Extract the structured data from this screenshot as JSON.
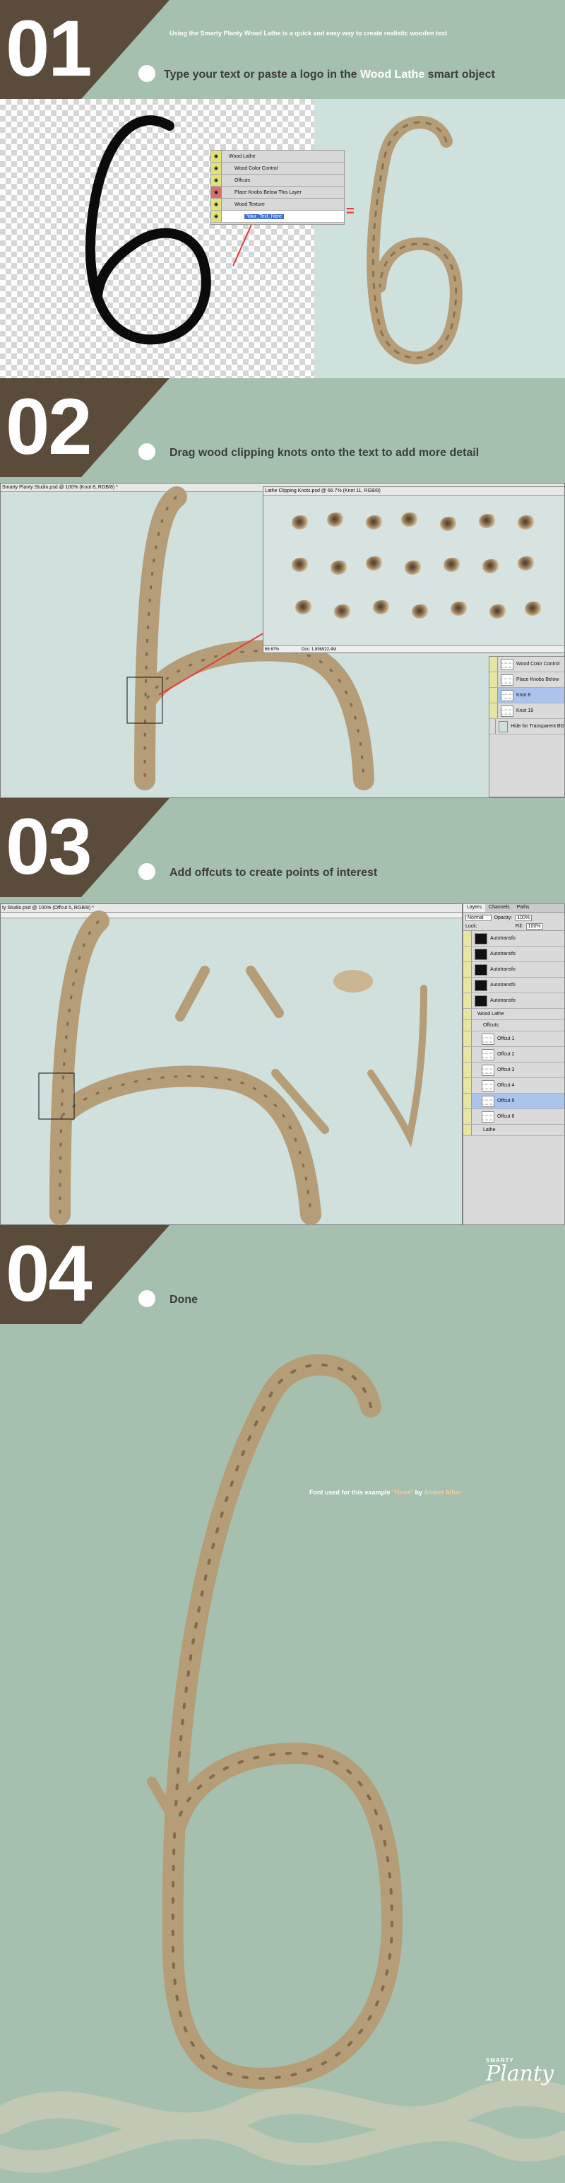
{
  "intro_text": "Using the Smarty Planty Wood Lathe is a quick and easy way to create realistic wooden text",
  "steps": [
    {
      "number": "01",
      "title_pre": "Type your text or paste a logo in the ",
      "title_highlight": "Wood Lathe",
      "title_post": " smart object"
    },
    {
      "number": "02",
      "title": "Drag wood clipping knots onto the text to add more detail"
    },
    {
      "number": "03",
      "title": "Add offcuts to create points of interest"
    },
    {
      "number": "04",
      "title": "Done"
    }
  ],
  "step1_layers": [
    {
      "label": "Wood Lathe",
      "eye": "yellow"
    },
    {
      "label": "Wood Color Control",
      "eye": "yellow"
    },
    {
      "label": "Offcuts",
      "eye": "yellow"
    },
    {
      "label": "Place Knobs Below This Layer",
      "eye": "red"
    },
    {
      "label": "Wood Texture",
      "eye": "yellow"
    },
    {
      "label": "Your_Text_Here",
      "eye": "yellow",
      "selected": true
    }
  ],
  "step1_equals": "=",
  "step2": {
    "main_title": "Smarty Planty Studio.psd @ 100% (Knot 8, RGB/8) *",
    "knot_title": "Lathe Clipping Knots.psd @ 66.7% (Knot 11, RGB/8)",
    "zoom": "66.67%",
    "doc_info": "Doc: 1.89M/22.4M",
    "layers": [
      {
        "label": "Wood Color Control",
        "thumb": "light"
      },
      {
        "label": "Place Knobs Below",
        "thumb": "light"
      },
      {
        "label": "Knot 8",
        "thumb": "light",
        "selected": true
      },
      {
        "label": "Knot 19",
        "thumb": "light"
      },
      {
        "label": "Hide for Transparent BG",
        "thumb": "light"
      }
    ]
  },
  "step3": {
    "main_title": "ty Studio.psd @ 100% (Offcut 5, RGB/8) *",
    "tabs": [
      "Layers",
      "Channels",
      "Paths"
    ],
    "blend_mode": "Normal",
    "opacity_label": "Opacity:",
    "opacity": "100%",
    "lock_label": "Lock:",
    "fill_label": "Fill:",
    "fill": "100%",
    "layers": [
      {
        "label": "Autotransfo",
        "thumb": "dark"
      },
      {
        "label": "Autotransfo",
        "thumb": "dark"
      },
      {
        "label": "Autotransfo",
        "thumb": "dark"
      },
      {
        "label": "Autotransfo",
        "thumb": "dark"
      },
      {
        "label": "Autotransfo",
        "thumb": "dark"
      },
      {
        "label": "Wood Lathe",
        "thumb": "none",
        "group": true
      },
      {
        "label": "Offcuts",
        "thumb": "none",
        "group": true
      },
      {
        "label": "Offcut 1",
        "thumb": "light"
      },
      {
        "label": "Offcut 2",
        "thumb": "light"
      },
      {
        "label": "Offcut 3",
        "thumb": "light"
      },
      {
        "label": "Offcut 4",
        "thumb": "light"
      },
      {
        "label": "Offcut 5",
        "thumb": "light",
        "selected": true
      },
      {
        "label": "Offcut 6",
        "thumb": "light"
      },
      {
        "label": "Lathe",
        "thumb": "none",
        "group": true
      }
    ]
  },
  "font_credit": {
    "pre": "Font used for this example ",
    "font": "\"Nexa\"",
    "mid": " by ",
    "author": "Ahmet Altun"
  },
  "logo": {
    "small": "SMARTY",
    "big": "Planty"
  },
  "colors": {
    "sage": "#a5c0ae",
    "brown": "#5a4b3b",
    "wood": "#b59d78"
  }
}
